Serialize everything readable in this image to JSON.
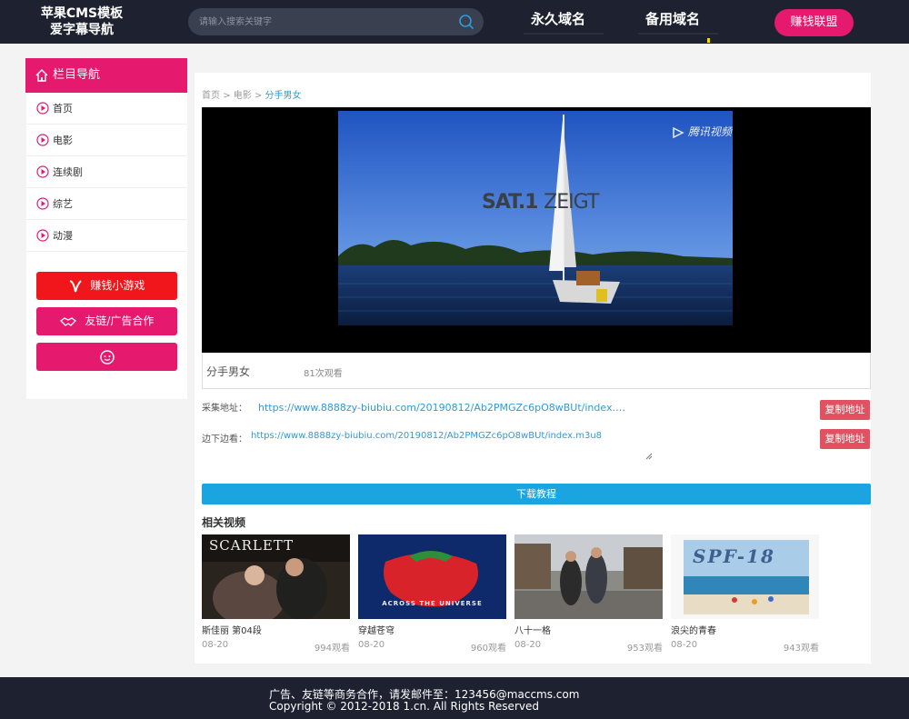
{
  "header": {
    "logo_line1": "苹果CMS模板",
    "logo_line2": "爱字幕导航",
    "search_placeholder": "请输入搜索关键字",
    "nav": [
      "永久域名",
      "备用域名"
    ],
    "earn_button": "赚钱联盟"
  },
  "sidebar": {
    "title": "栏目导航",
    "items": [
      "首页",
      "电影",
      "连续剧",
      "综艺",
      "动漫"
    ],
    "buttons": {
      "game": "赚钱小游戏",
      "friend_links": "友链/广告合作"
    },
    "colors": {
      "red": "#f0161b",
      "pink": "#e5196e"
    }
  },
  "breadcrumb": {
    "home": "首页",
    "sep": ">",
    "category": "电影",
    "current": "分手男女"
  },
  "player": {
    "channel_mark_bold": "SAT.1",
    "channel_mark_light": "ZEIGT",
    "watermark": "腾讯视频"
  },
  "video": {
    "title": "分手男女",
    "views": "81次观看"
  },
  "source": {
    "label": "采集地址：",
    "url": "https://www.8888zy-biubiu.com/20190812/Ab2PMGZc6pO8wBUt/index.m3...",
    "copy_label": "复制地址"
  },
  "mirror": {
    "label": "边下边看：",
    "url": "https://www.8888zy-biubiu.com/20190812/Ab2PMGZc6pO8wBUt/index.m3u8",
    "copy_label": "复制地址"
  },
  "download_button": "下载教程",
  "related": {
    "heading": "相关视频",
    "items": [
      {
        "name": "斯佳丽 第04段",
        "date": "08-20",
        "views": "994观看",
        "thumb_text": "SCARLETT"
      },
      {
        "name": "穿越苍穹",
        "date": "08-20",
        "views": "960观看",
        "thumb_text": "ACROSS THE UNIVERSE"
      },
      {
        "name": "八十一格",
        "date": "08-20",
        "views": "953观看",
        "thumb_text": ""
      },
      {
        "name": "浪尖的青春",
        "date": "08-20",
        "views": "943观看",
        "thumb_text": "SPF-18"
      }
    ]
  },
  "footer": {
    "line1": "广告、友链等商务合作，请发邮件至：123456@maccms.com",
    "line2": "Copyright © 2012-2018 1.cn. All Rights Reserved"
  }
}
